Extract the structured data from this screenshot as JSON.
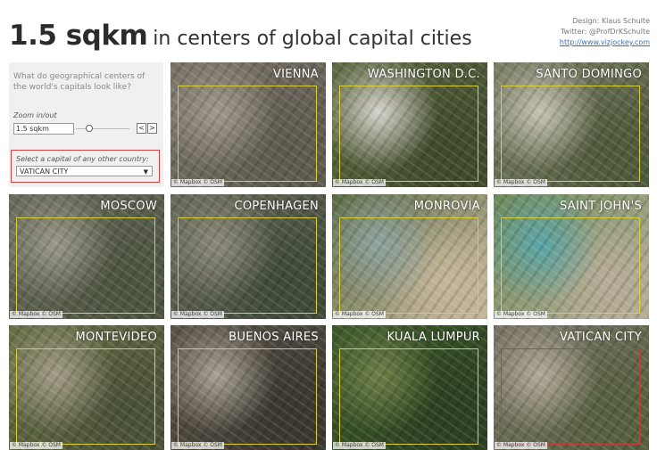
{
  "header": {
    "title_big": "1.5 sqkm",
    "title_rest": "in centers of global capital cities",
    "design": "Design: Klaus Schulte",
    "twitter": "Twitter: @ProfDrKSchulte",
    "link": "http://www.vizjockey.com"
  },
  "controls": {
    "question": "What do geographical centers of the world's capitals look like?",
    "zoom_label": "Zoom in/out",
    "zoom_value": "1.5 sqkm",
    "step_prev": "<",
    "step_next": ">",
    "select_label": "Select a capital of any other country:",
    "select_value": "VATICAN CITY",
    "select_arrow": "▼"
  },
  "tiles": [
    {
      "city": "VIENNA",
      "attribution": "© Mapbox © OSM",
      "palette": [
        "#7a7468",
        "#a19a8c",
        "#5e5a50"
      ]
    },
    {
      "city": "WASHINGTON D.C.",
      "attribution": "© Mapbox © OSM",
      "palette": [
        "#5f6b44",
        "#d6d4cc",
        "#3f4a2a"
      ]
    },
    {
      "city": "SANTO DOMINGO",
      "attribution": "© Mapbox © OSM",
      "palette": [
        "#7d8068",
        "#c7c3b4",
        "#4f5a3a"
      ]
    },
    {
      "city": "MOSCOW",
      "attribution": "© Mapbox © OSM",
      "palette": [
        "#6b6c5c",
        "#9a988a",
        "#4c5440"
      ]
    },
    {
      "city": "COPENHAGEN",
      "attribution": "© Mapbox © OSM",
      "palette": [
        "#6a6a5a",
        "#8d8a7c",
        "#3e4a38"
      ]
    },
    {
      "city": "MONROVIA",
      "attribution": "© Mapbox © OSM",
      "palette": [
        "#5a6a46",
        "#8fa4a0",
        "#c6b79a"
      ]
    },
    {
      "city": "SAINT JOHN'S",
      "attribution": "© Mapbox © OSM",
      "palette": [
        "#6b8a5a",
        "#5aa6a8",
        "#b7ad96"
      ]
    },
    {
      "city": "MONTEVIDEO",
      "attribution": "© Mapbox © OSM",
      "palette": [
        "#6a7048",
        "#a39d86",
        "#4a5236"
      ]
    },
    {
      "city": "BUENOS AIRES",
      "attribution": "© Mapbox © OSM",
      "palette": [
        "#5b5448",
        "#a8a294",
        "#3a3630"
      ]
    },
    {
      "city": "KUALA LUMPUR",
      "attribution": "© Mapbox © OSM",
      "palette": [
        "#3e5a2a",
        "#6f8048",
        "#2c4020"
      ]
    },
    {
      "city": "VATICAN CITY",
      "attribution": "© Mapbox © OSM",
      "palette": [
        "#7a7466",
        "#b3aa98",
        "#55603e"
      ],
      "highlight": true
    }
  ]
}
